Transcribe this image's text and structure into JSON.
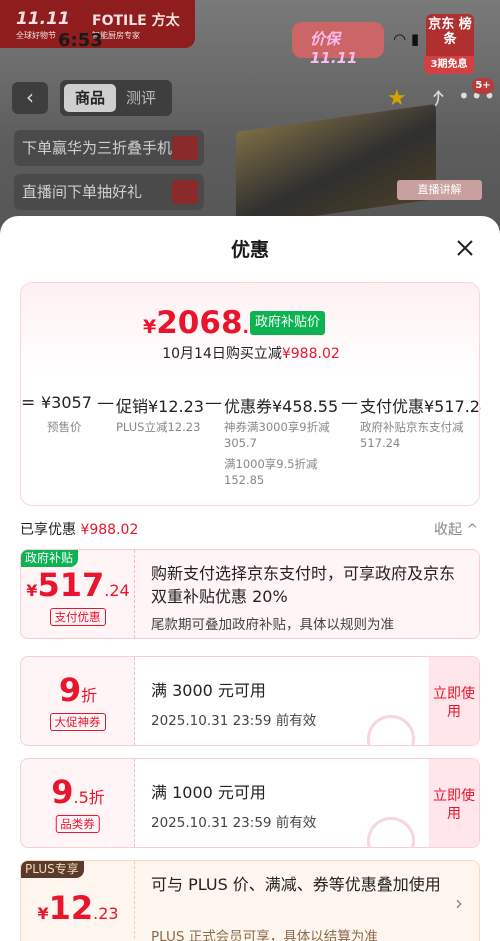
{
  "background": {
    "brand_logo": "11.11",
    "brand_logo_sub": "全球好物节",
    "brand_name": "FOTILE 方太",
    "brand_tagline": "智能厨房专家",
    "status_time": "6:53",
    "price_guard": "价保11.11",
    "jd_rank": "京东 榜条",
    "free_badge": "3期免息",
    "tabs": [
      "商品",
      "测评"
    ],
    "cart_badge": "5+",
    "promo_1": "下单赢华为三折叠手机",
    "promo_2": "直播间下单抽好礼",
    "live_badge": "直播讲解"
  },
  "sheet": {
    "title": "优惠",
    "summary": {
      "currency": "¥",
      "price_int": "2068",
      "price_dec": ".98",
      "gov_tag": "政府补贴价",
      "buy_line_prefix": "10月14日购买立减",
      "buy_line_amount": "¥988.02"
    },
    "formula": {
      "eq": "=",
      "presale_value": "¥3057",
      "presale_label": "预售价",
      "minus": "—",
      "promo_value": "促销¥12.23",
      "promo_sub": "PLUS立减12.23",
      "coupon_value": "优惠券¥458.55",
      "coupon_sub_1a": "神券满3000享9折减",
      "coupon_sub_1b": "305.7",
      "coupon_sub_2a": "满1000享9.5折减",
      "coupon_sub_2b": "152.85",
      "pay_value": "支付优惠¥517.24",
      "pay_sub_1": "政府补贴京东支付减",
      "pay_sub_2": "517.24"
    },
    "enjoyed_label": "已享优惠",
    "enjoyed_amount": "¥988.02",
    "collapse_label": "收起 ^",
    "coupons": [
      {
        "corner": "政府补贴",
        "currency": "¥",
        "amount_int": "517",
        "amount_dec": ".24",
        "label": "支付优惠",
        "title": "购新支付选择京东支付时，可享政府及京东双重补贴优惠 20%",
        "desc": "尾款期可叠加政府补贴，具体以规则为准"
      },
      {
        "amount_int": "9",
        "amount_unit": "折",
        "label": "大促神券",
        "title": "满 3000 元可用",
        "desc": "2025.10.31 23:59 前有效",
        "action": "立即使用"
      },
      {
        "amount_int": "9",
        "amount_dec": ".5",
        "amount_unit": "折",
        "label": "品类券",
        "title": "满 1000 元可用",
        "desc": "2025.10.31 23:59 前有效",
        "action": "立即使用"
      },
      {
        "corner": "PLUS专享",
        "currency": "¥",
        "amount_int": "12",
        "amount_dec": ".23",
        "title": "可与 PLUS 价、满减、券等优惠叠加使用",
        "desc": "PLUS 正式会员可享，具体以结算为准"
      }
    ]
  },
  "colors": {
    "accent_red": "#e8152c",
    "gov_green": "#0db352",
    "plus_brown": "#5a3a2a"
  }
}
